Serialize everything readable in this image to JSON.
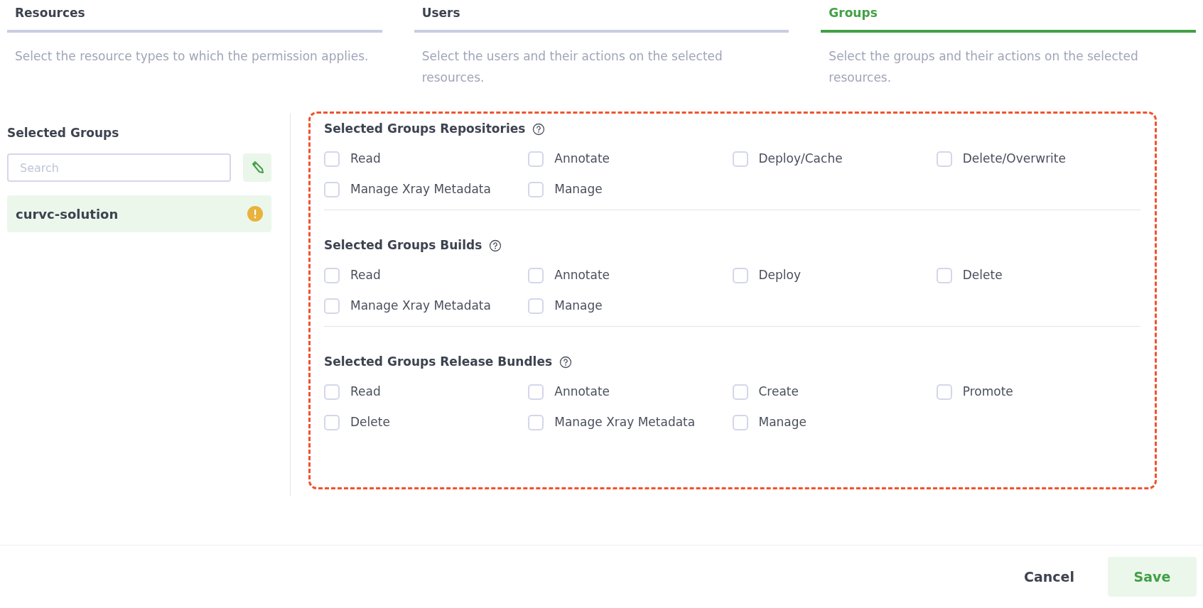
{
  "steps": [
    {
      "title": "Resources",
      "description": "Select the resource types to which the permission applies.",
      "selected": false
    },
    {
      "title": "Users",
      "description": "Select the users and their actions on the selected resources.",
      "selected": false
    },
    {
      "title": "Groups",
      "description": "Select the groups and their actions on the selected resources.",
      "selected": true
    }
  ],
  "groups_panel": {
    "title": "Selected Groups",
    "search": {
      "placeholder": "Search"
    },
    "items": [
      {
        "name": "curvc-solution",
        "selected": true,
        "warning": true
      }
    ]
  },
  "sections": [
    {
      "title": "Selected Groups Repositories",
      "actions": [
        {
          "label": "Read",
          "checked": false
        },
        {
          "label": "Annotate",
          "checked": false
        },
        {
          "label": "Deploy/Cache",
          "checked": false
        },
        {
          "label": "Delete/Overwrite",
          "checked": false
        },
        {
          "label": "Manage Xray Metadata",
          "checked": false
        },
        {
          "label": "Manage",
          "checked": false
        }
      ]
    },
    {
      "title": "Selected Groups Builds",
      "actions": [
        {
          "label": "Read",
          "checked": false
        },
        {
          "label": "Annotate",
          "checked": false
        },
        {
          "label": "Deploy",
          "checked": false
        },
        {
          "label": "Delete",
          "checked": false
        },
        {
          "label": "Manage Xray Metadata",
          "checked": false
        },
        {
          "label": "Manage",
          "checked": false
        }
      ]
    },
    {
      "title": "Selected Groups Release Bundles",
      "actions": [
        {
          "label": "Read",
          "checked": false
        },
        {
          "label": "Annotate",
          "checked": false
        },
        {
          "label": "Create",
          "checked": false
        },
        {
          "label": "Promote",
          "checked": false
        },
        {
          "label": "Delete",
          "checked": false
        },
        {
          "label": "Manage Xray Metadata",
          "checked": false
        },
        {
          "label": "Manage",
          "checked": false
        }
      ]
    }
  ],
  "footer": {
    "cancel": "Cancel",
    "save": "Save"
  }
}
